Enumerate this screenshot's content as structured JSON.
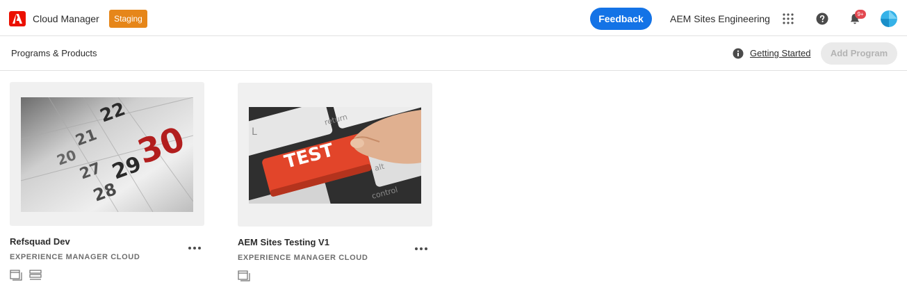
{
  "header": {
    "app_title": "Cloud Manager",
    "environment_badge": "Staging",
    "feedback_label": "Feedback",
    "org_name": "AEM Sites Engineering",
    "notification_count": "9+",
    "icons": [
      "adobe-logo",
      "apps-grid-icon",
      "help-icon",
      "bell-icon",
      "avatar"
    ]
  },
  "subheader": {
    "breadcrumb": "Programs & Products",
    "getting_started_label": "Getting Started",
    "add_program_label": "Add Program"
  },
  "programs": [
    {
      "name": "Refsquad Dev",
      "type": "EXPERIENCE MANAGER CLOUD",
      "thumbnail": "calendar",
      "calendar_numbers": [
        "22",
        "29",
        "30",
        "28",
        "21",
        "27",
        "20"
      ]
    },
    {
      "name": "AEM Sites Testing V1",
      "type": "EXPERIENCE MANAGER CLOUD",
      "thumbnail": "keyboard",
      "keyboard_labels": [
        "TEST",
        "return",
        "alt",
        "control",
        "L"
      ]
    }
  ],
  "colors": {
    "accent": "#1473e6",
    "badge": "#e68619",
    "brand": "#eb1000",
    "calendar_red": "#b21e1e",
    "test_key": "#e2452a"
  }
}
